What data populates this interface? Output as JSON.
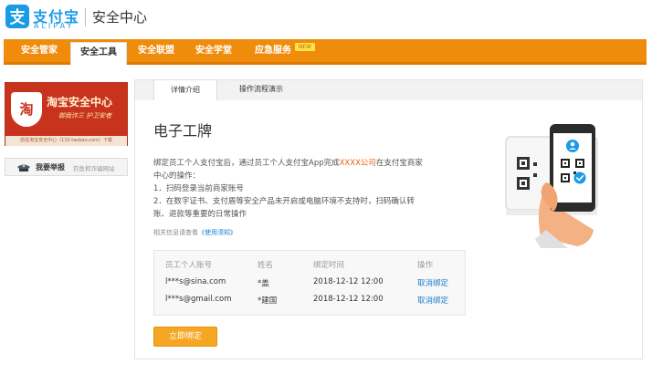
{
  "header": {
    "logo_cn": "支付宝",
    "logo_en": "ALIPAY",
    "site_title": "安全中心"
  },
  "nav": {
    "items": [
      {
        "label": "安全管家"
      },
      {
        "label": "安全工具"
      },
      {
        "label": "安全联盟"
      },
      {
        "label": "安全学堂"
      },
      {
        "label": "应急服务"
      }
    ],
    "active_index": 1,
    "new_badge": "NEW"
  },
  "sidebar": {
    "banner": {
      "shield_char": "淘",
      "title": "淘宝安全中心",
      "slogan": "御我诈三  护卫安者",
      "link_text": "前往淘宝安全中心（110.taobao.com）下载"
    },
    "report": {
      "label": "我要举报",
      "desc": "钓鱼和诈骗网站"
    }
  },
  "tabs": [
    {
      "label": "详情介绍"
    },
    {
      "label": "操作流程演示"
    }
  ],
  "active_tab": 0,
  "main": {
    "title": "电子工牌",
    "desc_line1_pre": "绑定员工个人支付宝后，通过员工个人支付宝App完成",
    "desc_line1_hl": "XXXX公司",
    "desc_line1_post": "在支付宝商家",
    "desc_line2": "中心的操作：",
    "desc_line3": "1．扫码登录当前商家账号",
    "desc_line4": "2．在数字证书、支付盾等安全产品未开启或电脑环境不支持时，扫码确认转",
    "desc_line5": "账、退款等重要的日常操作",
    "ref_pre": "相关信息请查看",
    "ref_link": "《使用须知》"
  },
  "table": {
    "headers": [
      "员工个人账号",
      "姓名",
      "绑定时间",
      "操作"
    ],
    "rows": [
      {
        "account": "l***s@sina.com",
        "name": "*盖",
        "time": "2018-12-12 12:00",
        "action": "取消绑定"
      },
      {
        "account": "l***s@gmail.com",
        "name": "*建国",
        "time": "2018-12-12 12:00",
        "action": "取消绑定"
      }
    ]
  },
  "bind_button": "立即绑定",
  "colors": {
    "brand_blue": "#1a9be6",
    "nav_orange": "#f08c0c",
    "button_orange": "#f5a623",
    "link_blue": "#1a7fd0",
    "highlight_orange": "#e8620e"
  }
}
